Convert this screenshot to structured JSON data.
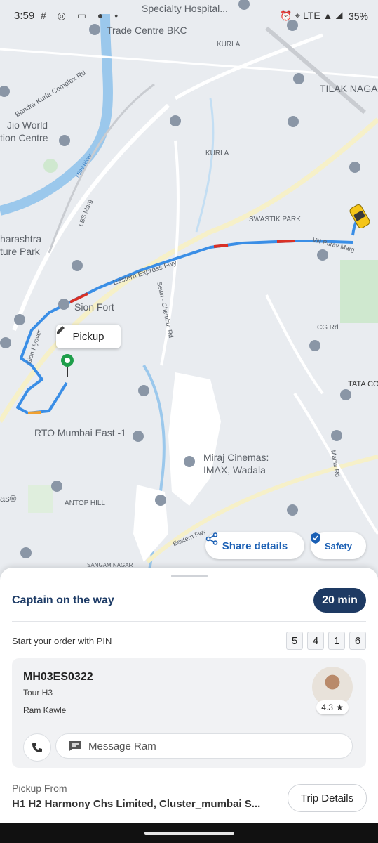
{
  "status_bar": {
    "time": "3:59",
    "left_icons": "# ◎ ▭ ● •",
    "right_icons": "⏰ ⌖ LTE ▲ ◢",
    "battery": "35%"
  },
  "map": {
    "labels": [
      "Specialty Hospital...",
      "Trade Centre BKC",
      "KURLA",
      "TILAK NAGA",
      "Bandra Kurla Complex Rd",
      "Jio World",
      "tion Centre",
      "KURLA",
      "Mithi River",
      "LBS Marg",
      "SWASTIK PARK",
      "VN Purav Marg",
      "harashtra",
      "ture Park",
      "Eastern Express Fwy",
      "Sion Fort",
      "Sewri - Chembur Rd",
      "CG Rd",
      "Sion Flyover",
      "TATA CO",
      "RTO Mumbai East -1",
      "Miraj Cinemas:",
      "IMAX, Wadala",
      "Mahul Rd",
      "as®",
      "ANTOP HILL",
      "Eastern Fwy",
      "SANGAM NAGAR"
    ],
    "pickup_callout": "Pickup",
    "share_details": "Share details",
    "safety": "Safety"
  },
  "sheet": {
    "status_title": "Captain on the way",
    "eta": "20 min",
    "pin_label": "Start your order with PIN",
    "pin": [
      "5",
      "4",
      "1",
      "6"
    ],
    "vehicle_plate": "MH03ES0322",
    "vehicle_model": "Tour H3",
    "driver_name": "Ram Kawle",
    "rating": "4.3",
    "message_placeholder": "Message Ram",
    "pickup_from_label": "Pickup From",
    "pickup_address": "H1 H2 Harmony Chs Limited, Cluster_mumbai S...",
    "trip_details": "Trip Details"
  },
  "colors": {
    "route_blue": "#3a8ee6",
    "route_red": "#d93025",
    "accent_navy": "#1e3a63",
    "link_blue": "#1a5fb4",
    "pickup_green": "#1e9e4a"
  }
}
